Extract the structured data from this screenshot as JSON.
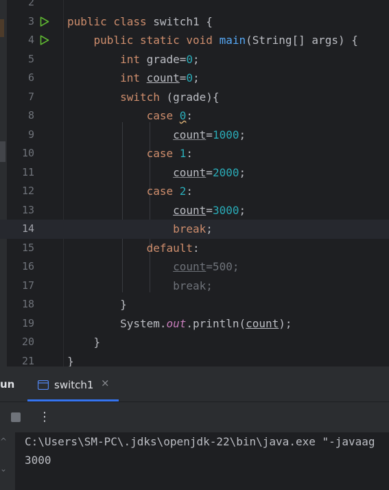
{
  "editor": {
    "lines": [
      {
        "n": "2"
      },
      {
        "n": "3",
        "run": true
      },
      {
        "n": "4",
        "run": true
      },
      {
        "n": "5"
      },
      {
        "n": "6"
      },
      {
        "n": "7"
      },
      {
        "n": "8"
      },
      {
        "n": "9"
      },
      {
        "n": "10"
      },
      {
        "n": "11"
      },
      {
        "n": "12"
      },
      {
        "n": "13"
      },
      {
        "n": "14",
        "current": true
      },
      {
        "n": "15"
      },
      {
        "n": "16"
      },
      {
        "n": "17"
      },
      {
        "n": "18"
      },
      {
        "n": "19"
      },
      {
        "n": "20"
      },
      {
        "n": "21"
      }
    ],
    "tokens": {
      "l3_kw": "public class",
      "l3_name": " switch1 {",
      "l4_kw1": "public static void",
      "l4_fn": "main",
      "l4_rest": "(String[] args) {",
      "l5_kw": "int",
      "l5_mid": " grade=",
      "l5_num": "0",
      "l5_end": ";",
      "l6_kw": "int",
      "l6_sp": " ",
      "l6_var": "count",
      "l6_eq": "=",
      "l6_num": "0",
      "l6_end": ";",
      "l7_kw": "switch",
      "l7_rest": " (grade){",
      "l8_kw": "case",
      "l8_sp": " ",
      "l8_num": "0",
      "l8_end": ":",
      "l9_var": "count",
      "l9_eq": "=",
      "l9_num": "1000",
      "l9_end": ";",
      "l10_kw": "case",
      "l10_num": " 1",
      "l10_end": ":",
      "l11_var": "count",
      "l11_eq": "=",
      "l11_num": "2000",
      "l11_end": ";",
      "l12_kw": "case",
      "l12_num": " 2",
      "l12_end": ":",
      "l13_var": "count",
      "l13_eq": "=",
      "l13_num": "3000",
      "l13_end": ";",
      "l14_kw": "break",
      "l14_end": ";",
      "l15_kw": "default",
      "l15_end": ":",
      "l16_var": "count",
      "l16_rest": "=500;",
      "l17_text": "break;",
      "l18_text": "}",
      "l19_a": "System.",
      "l19_out": "out",
      "l19_b": ".println(",
      "l19_var": "count",
      "l19_c": ");",
      "l20_text": "}",
      "l21_text": "}"
    }
  },
  "run_panel": {
    "run_label": "un",
    "tab_label": "switch1",
    "tab_close": "×",
    "menu_glyph": "⋮",
    "console_lines": [
      "C:\\Users\\SM-PC\\.jdks\\openjdk-22\\bin\\java.exe \"-javaag",
      "3000"
    ]
  },
  "icons": {
    "run": "run-play-icon",
    "stop": "stop-icon",
    "console_tab": "console-window-icon"
  },
  "colors": {
    "background": "#1e1f22",
    "keyword": "#cf8e6d",
    "number": "#2aacb8",
    "function": "#56a8f5",
    "run_green": "#5fb832",
    "accent_tab": "#3574f0"
  }
}
